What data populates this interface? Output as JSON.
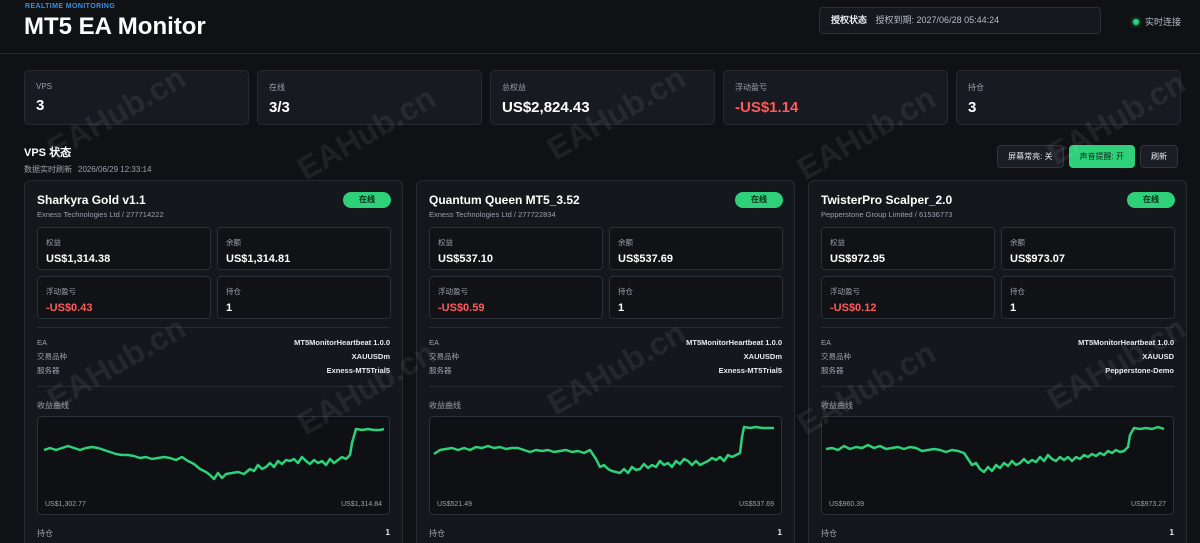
{
  "header": {
    "eyebrow": "REALTIME MONITORING",
    "title": "MT5 EA Monitor",
    "license_label": "授权状态",
    "license_value": "授权到期: 2027/06/28 05:44:24",
    "live_label": "实时连接"
  },
  "stats": [
    {
      "label": "VPS",
      "value": "3",
      "negative": false
    },
    {
      "label": "在线",
      "value": "3/3",
      "negative": false
    },
    {
      "label": "总权益",
      "value": "US$2,824.43",
      "negative": false
    },
    {
      "label": "浮动盈亏",
      "value": "-US$1.14",
      "negative": true
    },
    {
      "label": "持仓",
      "value": "3",
      "negative": false
    }
  ],
  "vps_section": {
    "title": "VPS 状态",
    "refresh_label": "数据实时刷新",
    "refresh_time": "2026/06/29 12:33:14"
  },
  "controls": {
    "screen_on": "屏幕常亮: 关",
    "sound": "声音提醒: 开",
    "refresh": "刷新"
  },
  "cards": [
    {
      "name": "Sharkyra Gold v1.1",
      "broker": "Exness Technologies Ltd / 277714222",
      "status": "在线",
      "metrics": [
        {
          "label": "权益",
          "value": "US$1,314.38"
        },
        {
          "label": "余额",
          "value": "US$1,314.81"
        },
        {
          "label": "浮动盈亏",
          "value": "-US$0.43"
        },
        {
          "label": "持仓",
          "value": "1"
        }
      ],
      "info": [
        {
          "label": "EA",
          "value": "MT5MonitorHeartbeat 1.0.0"
        },
        {
          "label": "交易品种",
          "value": "XAUUSDm"
        },
        {
          "label": "服务器",
          "value": "Exness-MT5Trial5"
        }
      ],
      "curve_title": "收益曲线",
      "curve_min": "US$1,302.77",
      "curve_max": "US$1,314.84",
      "positions_label": "持仓",
      "positions_value": "1"
    },
    {
      "name": "Quantum Queen MT5_3.52",
      "broker": "Exness Technologies Ltd / 277722834",
      "status": "在线",
      "metrics": [
        {
          "label": "权益",
          "value": "US$537.10"
        },
        {
          "label": "余额",
          "value": "US$537.69"
        },
        {
          "label": "浮动盈亏",
          "value": "-US$0.59"
        },
        {
          "label": "持仓",
          "value": "1"
        }
      ],
      "info": [
        {
          "label": "EA",
          "value": "MT5MonitorHeartbeat 1.0.0"
        },
        {
          "label": "交易品种",
          "value": "XAUUSDm"
        },
        {
          "label": "服务器",
          "value": "Exness-MT5Trial5"
        }
      ],
      "curve_title": "收益曲线",
      "curve_min": "US$521.49",
      "curve_max": "US$537.69",
      "positions_label": "持仓",
      "positions_value": "1"
    },
    {
      "name": "TwisterPro Scalper_2.0",
      "broker": "Pepperstone Group Limited / 61536773",
      "status": "在线",
      "metrics": [
        {
          "label": "权益",
          "value": "US$972.95"
        },
        {
          "label": "余额",
          "value": "US$973.07"
        },
        {
          "label": "浮动盈亏",
          "value": "-US$0.12"
        },
        {
          "label": "持仓",
          "value": "1"
        }
      ],
      "info": [
        {
          "label": "EA",
          "value": "MT5MonitorHeartbeat 1.0.0"
        },
        {
          "label": "交易品种",
          "value": "XAUUSD"
        },
        {
          "label": "服务器",
          "value": "Pepperstone-Demo"
        }
      ],
      "curve_title": "收益曲线",
      "curve_min": "US$960.39",
      "curve_max": "US$973.27",
      "positions_label": "持仓",
      "positions_value": "1"
    }
  ],
  "watermark": "EAHub.cn",
  "colors": {
    "accent": "#2fd07a",
    "negative": "#ff5a5a",
    "brand": "#3d8fe0"
  }
}
